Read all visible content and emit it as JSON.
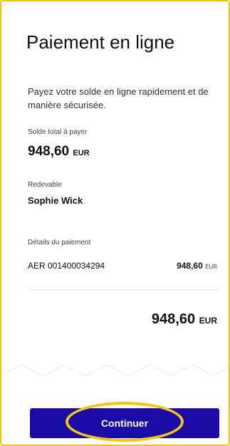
{
  "page": {
    "title": "Paiement en ligne",
    "intro": "Payez votre solde en ligne rapidement et de manière sécurisée."
  },
  "balance": {
    "label": "Solde total à payer",
    "amount": "948,60",
    "currency": "EUR"
  },
  "payer": {
    "label": "Redevable",
    "name": "Sophie Wick"
  },
  "details": {
    "label": "Détails du paiement",
    "items": [
      {
        "reference": "AER 001400034294",
        "amount": "948,60",
        "currency": "EUR"
      }
    ]
  },
  "total": {
    "amount": "948,60",
    "currency": "EUR"
  },
  "actions": {
    "continue_label": "Continuer"
  },
  "colors": {
    "button": "#1a0ba8",
    "frame_border": "#f3c21a",
    "highlight_ring": "#f4c418"
  }
}
